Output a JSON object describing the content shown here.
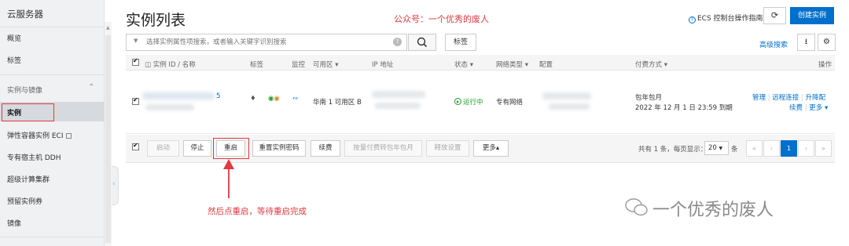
{
  "sidebar": {
    "title": "云服务器",
    "items": [
      {
        "label": "概览"
      },
      {
        "label": "标签"
      }
    ],
    "group_label": "实例与镜像",
    "active_item": "实例",
    "sub_items": [
      {
        "label": "弹性容器实例 ECI"
      },
      {
        "label": "专有宿主机 DDH"
      },
      {
        "label": "超级计算集群"
      },
      {
        "label": "预留实例券"
      },
      {
        "label": "镜像"
      }
    ]
  },
  "header": {
    "title": "实例列表",
    "annotation": "公众号：一个优秀的废人",
    "guide_link": "ECS 控制台操作指南",
    "create_button": "创建实例"
  },
  "search": {
    "placeholder": "选择实例属性项搜索，或者输入关键字识别搜索",
    "tag_button": "标签",
    "advanced": "高级搜索"
  },
  "table": {
    "columns": [
      "实例 ID / 名称",
      "标签",
      "监控",
      "可用区",
      "IP 地址",
      "状态",
      "网络类型",
      "配置",
      "付费方式",
      "操作"
    ],
    "row": {
      "id_suffix": "5",
      "zone": "华南 1 可用区 B",
      "status": "运行中",
      "network": "专有网络",
      "billing_type": "包年包月",
      "expiry": "2022 年 12 月 1 日 23:59 到期",
      "actions": [
        "管理",
        "远程连接",
        "升降配",
        "续费",
        "更多"
      ]
    }
  },
  "action_bar": {
    "buttons": [
      "启动",
      "停止",
      "重启",
      "重置实例密码",
      "续费",
      "按量付费转包年包月",
      "释放设置",
      "更多"
    ],
    "pager_text": "共有 1 条，每页显示：",
    "page_size": "20",
    "page_unit": "条",
    "current_page": "1"
  },
  "annotations": {
    "restart_hint": "然后点重启，等待重启完成",
    "watermark": "一个优秀的废人"
  },
  "colors": {
    "accent": "#0070cc",
    "annotation_red": "#e0393e",
    "running_green": "#1e9e27"
  }
}
